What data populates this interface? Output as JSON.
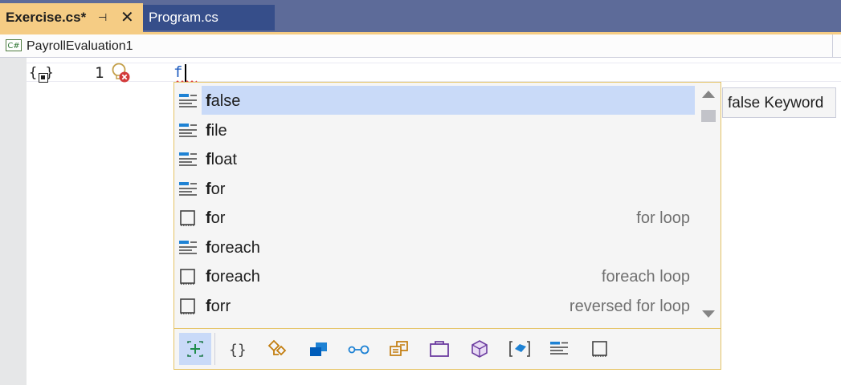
{
  "tabs": [
    {
      "label": "Exercise.cs*",
      "active": true,
      "pin": "⊣",
      "close": "✕"
    },
    {
      "label": "Program.cs",
      "active": false
    }
  ],
  "navbar": {
    "project_icon": "C#",
    "project": "PayrollEvaluation1"
  },
  "editor": {
    "line_number": "1",
    "code": "f"
  },
  "completion": {
    "items": [
      {
        "prefix": "f",
        "rest": "alse",
        "desc": "",
        "icon": "keyword-icon",
        "selected": true
      },
      {
        "prefix": "f",
        "rest": "ile",
        "desc": "",
        "icon": "keyword-icon"
      },
      {
        "prefix": "f",
        "rest": "loat",
        "desc": "",
        "icon": "keyword-icon"
      },
      {
        "prefix": "f",
        "rest": "or",
        "desc": "",
        "icon": "keyword-icon"
      },
      {
        "prefix": "f",
        "rest": "or",
        "desc": "for loop",
        "icon": "snippet-icon"
      },
      {
        "prefix": "f",
        "rest": "oreach",
        "desc": "",
        "icon": "keyword-icon"
      },
      {
        "prefix": "f",
        "rest": "oreach",
        "desc": "foreach loop",
        "icon": "snippet-icon"
      },
      {
        "prefix": "f",
        "rest": "orr",
        "desc": "reversed for loop",
        "icon": "snippet-icon"
      }
    ],
    "tooltip": "false Keyword",
    "filters": [
      "expander-icon",
      "namespace-icon",
      "class-icon",
      "struct-icon",
      "interface-icon",
      "enum-icon",
      "delegate-icon",
      "method-icon",
      "local-icon",
      "keyword-filter-icon",
      "snippet-filter-icon"
    ]
  },
  "colors": {
    "tab_active": "#f5cc84",
    "tab_bar": "#5d6b99",
    "selection": "#c9daf8",
    "popup_border": "#e5c365"
  }
}
